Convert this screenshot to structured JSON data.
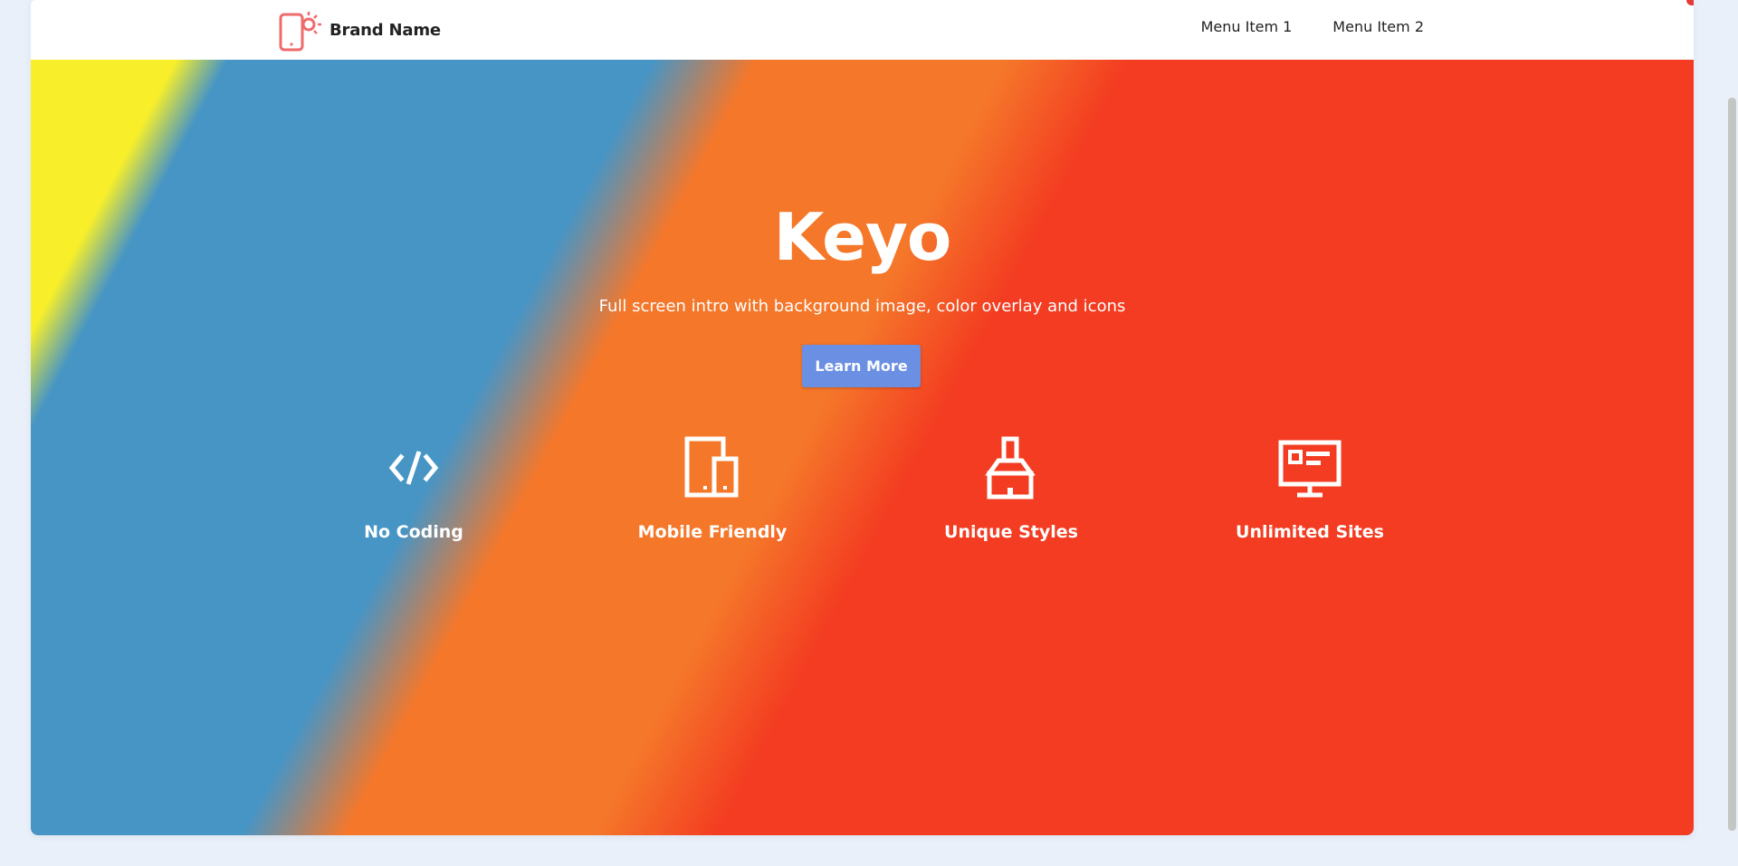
{
  "header": {
    "brand_name": "Brand Name",
    "menu": [
      "Menu Item 1",
      "Menu Item 2"
    ]
  },
  "hero": {
    "title": "Keyo",
    "subtitle": "Full screen intro with background image, color overlay and icons",
    "cta_label": "Learn More",
    "features": [
      {
        "label": "No Coding",
        "icon": "code-icon"
      },
      {
        "label": "Mobile Friendly",
        "icon": "devices-icon"
      },
      {
        "label": "Unique Styles",
        "icon": "paint-brush-icon"
      },
      {
        "label": "Unlimited Sites",
        "icon": "monitor-icon"
      }
    ]
  },
  "colors": {
    "accent_button": "#6a8fe3",
    "brand_logo": "#ef6b6b",
    "hero_red": "#f33c21",
    "hero_orange": "#f5772a",
    "hero_blue": "#4795c5",
    "hero_yellow": "#f8ef2a"
  }
}
